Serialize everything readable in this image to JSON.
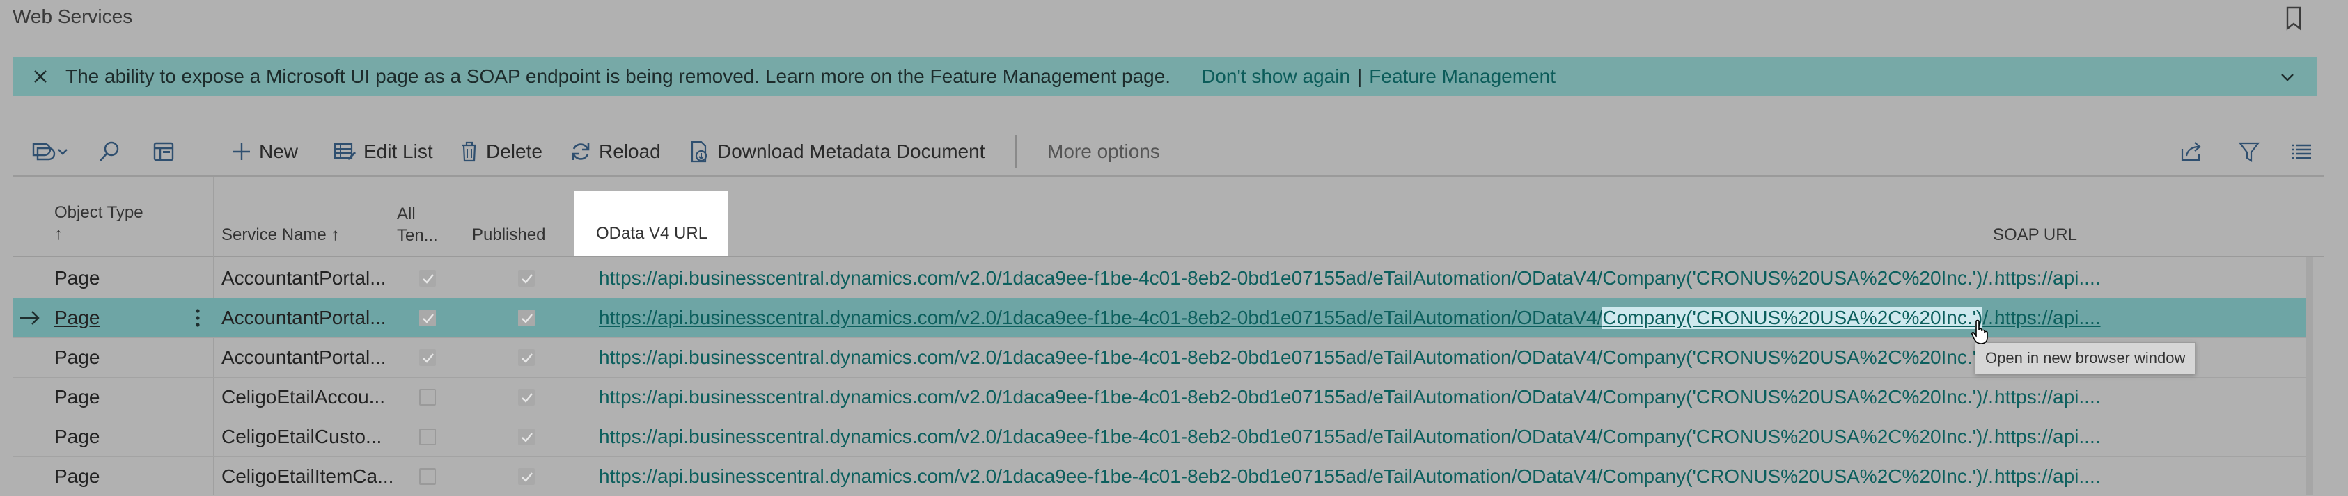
{
  "page": {
    "title": "Web Services"
  },
  "banner": {
    "message": "The ability to expose a Microsoft UI page as a SOAP endpoint is being removed. Learn more on the Feature Management page.",
    "dont_show": "Don't show again",
    "separator": "|",
    "feature_mgmt": "Feature Management"
  },
  "toolbar": {
    "new": "New",
    "edit_list": "Edit List",
    "delete": "Delete",
    "reload": "Reload",
    "download": "Download Metadata Document",
    "more": "More options"
  },
  "columns": {
    "object_type": "Object Type",
    "service_name": "Service Name ↑",
    "all_tenants_1": "All",
    "all_tenants_2": "Ten...",
    "published": "Published",
    "odata_v4_url": "OData V4 URL",
    "soap_url": "SOAP URL",
    "sort_arrow": "↑"
  },
  "rows": [
    {
      "type": "Page",
      "service": "AccountantPortal...",
      "all_tenants": true,
      "published": true,
      "odata": "https://api.businesscentral.dynamics.com/v2.0/1daca9ee-f1be-4c01-8eb2-0bd1e07155ad/eTailAutomation/ODataV4/Company('CRONUS%20USA%2C%20Inc.')/...",
      "soap": "https://api...."
    },
    {
      "type": "Page",
      "service": "AccountantPortal...",
      "all_tenants": true,
      "published": true,
      "odata_a": "https://api.businesscentral.dynamics.com/v2.0/1daca9ee-f1be-4c01-8eb2-0bd1e07155ad/eTailAutomation/ODataV4/",
      "odata_b": "Company('CRONUS%20USA%2C%20Inc.')",
      "odata_c": "/...",
      "soap": "https://api....",
      "selected": true
    },
    {
      "type": "Page",
      "service": "AccountantPortal...",
      "all_tenants": true,
      "published": true,
      "odata": "https://api.businesscentral.dynamics.com/v2.0/1daca9ee-f1be-4c01-8eb2-0bd1e07155ad/eTailAutomation/ODataV4/Company('CRONUS%20USA%2C%20Inc.')/...",
      "soap": "https://api...."
    },
    {
      "type": "Page",
      "service": "CeligoEtailAccou...",
      "all_tenants": false,
      "published": true,
      "odata": "https://api.businesscentral.dynamics.com/v2.0/1daca9ee-f1be-4c01-8eb2-0bd1e07155ad/eTailAutomation/ODataV4/Company('CRONUS%20USA%2C%20Inc.')/...",
      "soap": "https://api...."
    },
    {
      "type": "Page",
      "service": "CeligoEtailCusto...",
      "all_tenants": false,
      "published": true,
      "odata": "https://api.businesscentral.dynamics.com/v2.0/1daca9ee-f1be-4c01-8eb2-0bd1e07155ad/eTailAutomation/ODataV4/Company('CRONUS%20USA%2C%20Inc.')/...",
      "soap": "https://api...."
    },
    {
      "type": "Page",
      "service": "CeligoEtailItemCa...",
      "all_tenants": false,
      "published": true,
      "odata": "https://api.businesscentral.dynamics.com/v2.0/1daca9ee-f1be-4c01-8eb2-0bd1e07155ad/eTailAutomation/ODataV4/Company('CRONUS%20USA%2C%20Inc.')/...",
      "soap": "https://api...."
    }
  ],
  "tooltip": "Open in new browser window",
  "icons": [
    "bookmark-icon",
    "close-icon",
    "chevron-down-icon",
    "view-switch-icon",
    "search-icon",
    "filter-pane-icon",
    "plus-icon",
    "edit-list-icon",
    "delete-icon",
    "reload-icon",
    "download-icon",
    "share-icon",
    "filter-icon",
    "list-view-icon",
    "row-arrow-icon",
    "row-menu-icon",
    "checkbox-icon",
    "cursor-icon"
  ],
  "colors": {
    "banner": "#77a9a7",
    "link": "#0c5f5d",
    "selected_row": "#6ea5a5",
    "background": "#b1b1b1"
  }
}
